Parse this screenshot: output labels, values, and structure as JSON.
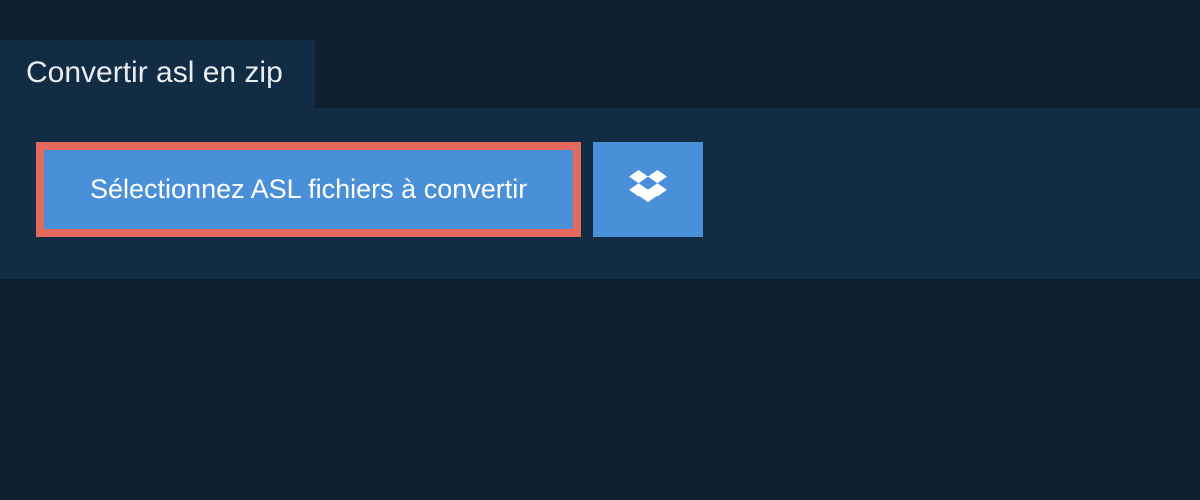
{
  "tab": {
    "title": "Convertir asl en zip"
  },
  "actions": {
    "select_files_label": "Sélectionnez ASL fichiers à convertir"
  },
  "colors": {
    "background_dark": "#0c2030",
    "panel": "#122c44",
    "button": "#4a90d9",
    "button_border": "#e36a5c",
    "text_light": "#e8edf2",
    "text_white": "#ffffff"
  }
}
